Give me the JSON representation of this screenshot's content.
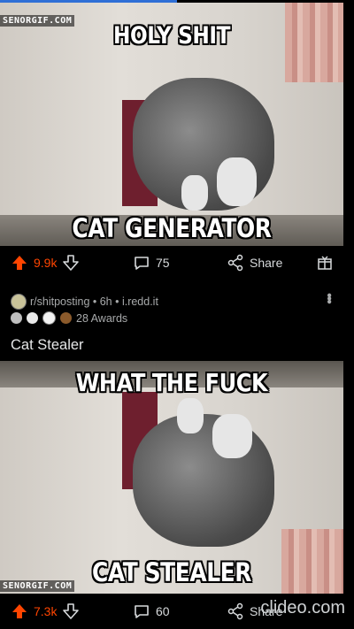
{
  "post1": {
    "watermark": "SENORGIF.COM",
    "top_text": "HOLY SHIT",
    "bottom_text": "CAT GENERATOR",
    "upvotes": "9.9k",
    "comments": "75",
    "share_label": "Share"
  },
  "post2": {
    "subreddit_line": "r/shitposting • 6h • i.redd.it",
    "awards_label": "28 Awards",
    "title": "Cat Stealer",
    "watermark": "SENORGIF.COM",
    "top_text": "WHAT THE FUCK",
    "bottom_text": "CAT STEALER",
    "upvotes": "7.3k",
    "comments": "60",
    "share_label": "Share"
  },
  "overlay": {
    "clideo_watermark": "clideo.com"
  },
  "colors": {
    "upvote": "#ff4500",
    "background": "#000000",
    "progress": "#2f6fd6"
  },
  "icons": [
    "upvote-arrow-icon",
    "downvote-arrow-icon",
    "comment-bubble-icon",
    "share-icon",
    "award-add-icon",
    "kebab-menu-icon"
  ]
}
